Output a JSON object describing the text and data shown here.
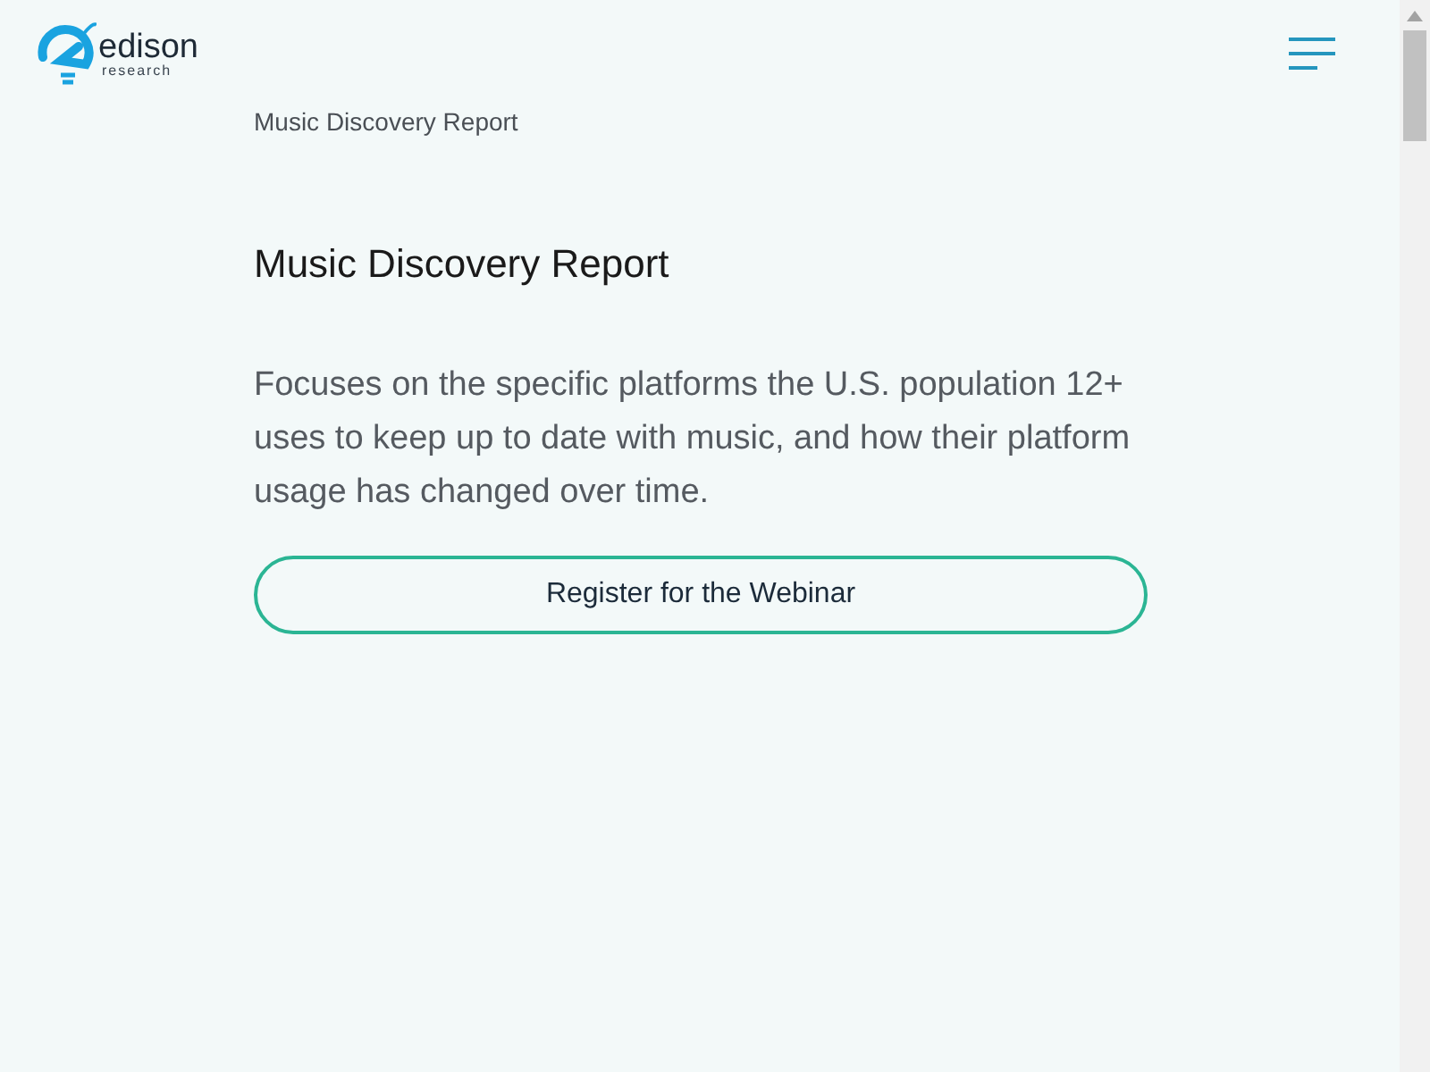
{
  "logo": {
    "name": "edison",
    "tagline": "research"
  },
  "breadcrumb": "Music Discovery Report",
  "title": "Music Discovery Report",
  "description": "Focuses on the specific platforms the U.S. population 12+ uses to keep up to date with music, and how their platform usage has changed over time.",
  "button": "Register for the Webinar"
}
